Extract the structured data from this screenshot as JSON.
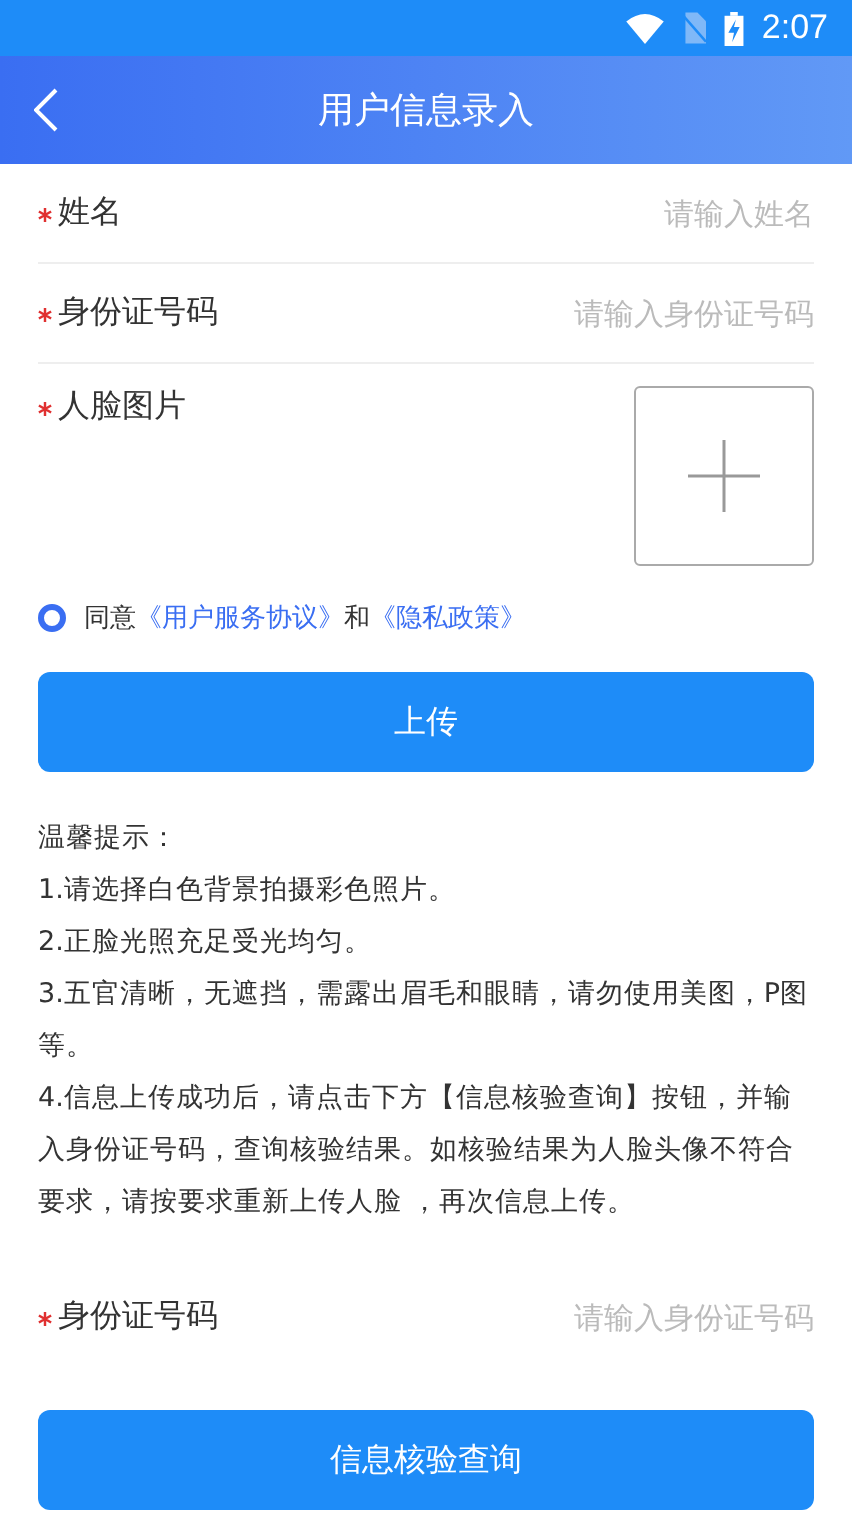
{
  "status_bar": {
    "time": "2:07"
  },
  "header": {
    "title": "用户信息录入"
  },
  "fields": [
    {
      "kind": "text",
      "label": "姓名",
      "required": true,
      "placeholder": "请输入姓名"
    },
    {
      "kind": "text",
      "label": "身份证号码",
      "required": true,
      "placeholder": "请输入身份证号码"
    },
    {
      "kind": "photo",
      "label": "人脸图片",
      "required": true
    }
  ],
  "agreement": {
    "checked": true,
    "prefix": "同意",
    "link_1": "《用户服务协议》",
    "joiner": "和",
    "link_2": "《隐私政策》"
  },
  "upload_button": "上传",
  "tips": {
    "title": "温馨提示：",
    "lines": [
      "1.请选择白色背景拍摄彩色照片。",
      "2.正脸光照充足受光均匀。",
      "3.五官清晰，无遮挡，需露出眉毛和眼睛，请勿使用美图，P图等。",
      "4.信息上传成功后，请点击下方【信息核验查询】按钮，并输入身份证号码，查询核验结果。如核验结果为人脸头像不符合要求，请按要求重新上传人脸 ，再次信息上传。"
    ]
  },
  "query": {
    "label": "身份证号码",
    "required": true,
    "placeholder": "请输入身份证号码",
    "button": "信息核验查询"
  }
}
